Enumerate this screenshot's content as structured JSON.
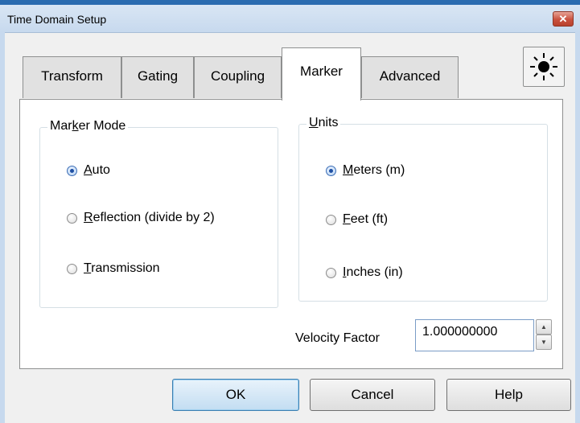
{
  "window": {
    "title": "Time Domain Setup",
    "close_icon": "close-icon"
  },
  "tabs": [
    {
      "label": "Transform",
      "active": false
    },
    {
      "label": "Gating",
      "active": false
    },
    {
      "label": "Coupling",
      "active": false
    },
    {
      "label": "Marker",
      "active": true
    },
    {
      "label": "Advanced",
      "active": false
    }
  ],
  "toolbar": {
    "sun_icon": "sun-icon"
  },
  "marker_mode": {
    "label_pre": "Mar",
    "label_u": "k",
    "label_post": "er Mode",
    "options": [
      {
        "u": "A",
        "rest": "uto",
        "checked": true
      },
      {
        "u": "R",
        "rest": "eflection (divide by 2)",
        "checked": false
      },
      {
        "u": "T",
        "rest": "ransmission",
        "checked": false
      }
    ]
  },
  "units": {
    "label_u": "U",
    "label_post": "nits",
    "options": [
      {
        "u": "M",
        "rest": "eters (m)",
        "checked": true
      },
      {
        "u": "F",
        "rest": "eet (ft)",
        "checked": false
      },
      {
        "u": "I",
        "rest": "nches (in)",
        "checked": false
      }
    ]
  },
  "velocity": {
    "label": "Velocity Factor",
    "value": "1.000000000"
  },
  "buttons": {
    "ok": "OK",
    "cancel": "Cancel",
    "help": "Help"
  },
  "colors": {
    "accent": "#2b6cb0",
    "radio_selected": "#1e4fa3",
    "default_button": "#3c7fb1"
  }
}
